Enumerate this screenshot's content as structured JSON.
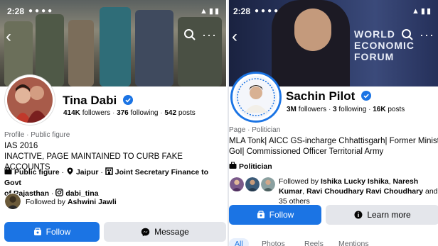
{
  "left": {
    "status": {
      "time": "2:28"
    },
    "profile": {
      "name": "Tina Dabi",
      "followers": "414K",
      "followers_label": "followers",
      "following": "376",
      "following_label": "following",
      "posts": "542",
      "posts_label": "posts",
      "category": "Profile · Public figure",
      "bio_line1": "IAS 2016",
      "bio_line2": "INACTIVE, PAGE MAINTAINED TO CURB FAKE ACCOUNTS",
      "detail_public_figure": "Public figure",
      "detail_location": "Jaipur",
      "detail_job_a": "Joint Secretary Finance to Govt",
      "detail_job_b": "of Rajasthan",
      "detail_instagram": "dabi_tina",
      "followed_by_prefix": "Followed by",
      "followed_by_name": "Ashwini Jawli"
    },
    "buttons": {
      "follow": "Follow",
      "message": "Message"
    }
  },
  "right": {
    "status": {
      "time": "2:28"
    },
    "cover_text": {
      "line1": "WORLD",
      "line2": "ECONOMIC",
      "line3": "FORUM"
    },
    "profile": {
      "name": "Sachin Pilot",
      "followers": "3M",
      "followers_label": "followers",
      "following": "3",
      "following_label": "following",
      "posts": "16K",
      "posts_label": "posts",
      "category": "Page · Politician",
      "bio_line1": "MLA Tonk| AICC GS-incharge Chhattisgarh| Former Ministe",
      "bio_line2": "GoI| Commissioned Officer Territorial Army",
      "detail_politician": "Politician",
      "followed_by_prefix": "Followed by",
      "followed_by_1": "Ishika Lucky Ishika",
      "followed_by_2": "Naresh Kumar",
      "followed_by_3": "Ravi Choudhary Ravi Choudhary",
      "followed_by_suffix": "and 35 others"
    },
    "buttons": {
      "follow": "Follow",
      "learn_more": "Learn more"
    },
    "tabs": [
      "All",
      "Photos",
      "Reels",
      "Mentions"
    ]
  },
  "colors": {
    "accent": "#1b74e4",
    "muted": "#65676b"
  }
}
